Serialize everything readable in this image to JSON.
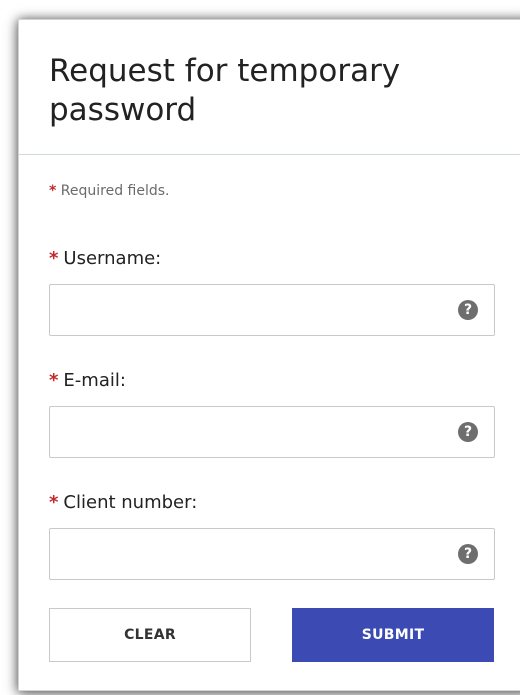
{
  "header": {
    "title": "Request for temporary password"
  },
  "form": {
    "required_star": "*",
    "required_note": "Required fields.",
    "fields": [
      {
        "label": "Username:",
        "value": "",
        "placeholder": "",
        "help_icon": "question-circle-icon",
        "help_glyph": "?"
      },
      {
        "label": "E-mail:",
        "value": "",
        "placeholder": "",
        "help_icon": "question-circle-icon",
        "help_glyph": "?"
      },
      {
        "label": "Client number:",
        "value": "",
        "placeholder": "",
        "help_icon": "question-circle-icon",
        "help_glyph": "?"
      }
    ]
  },
  "buttons": {
    "clear_label": "CLEAR",
    "submit_label": "SUBMIT"
  },
  "colors": {
    "required_star": "#c0282e",
    "submit_background": "#3c4bb4",
    "help_icon": "#6e6e6e"
  }
}
